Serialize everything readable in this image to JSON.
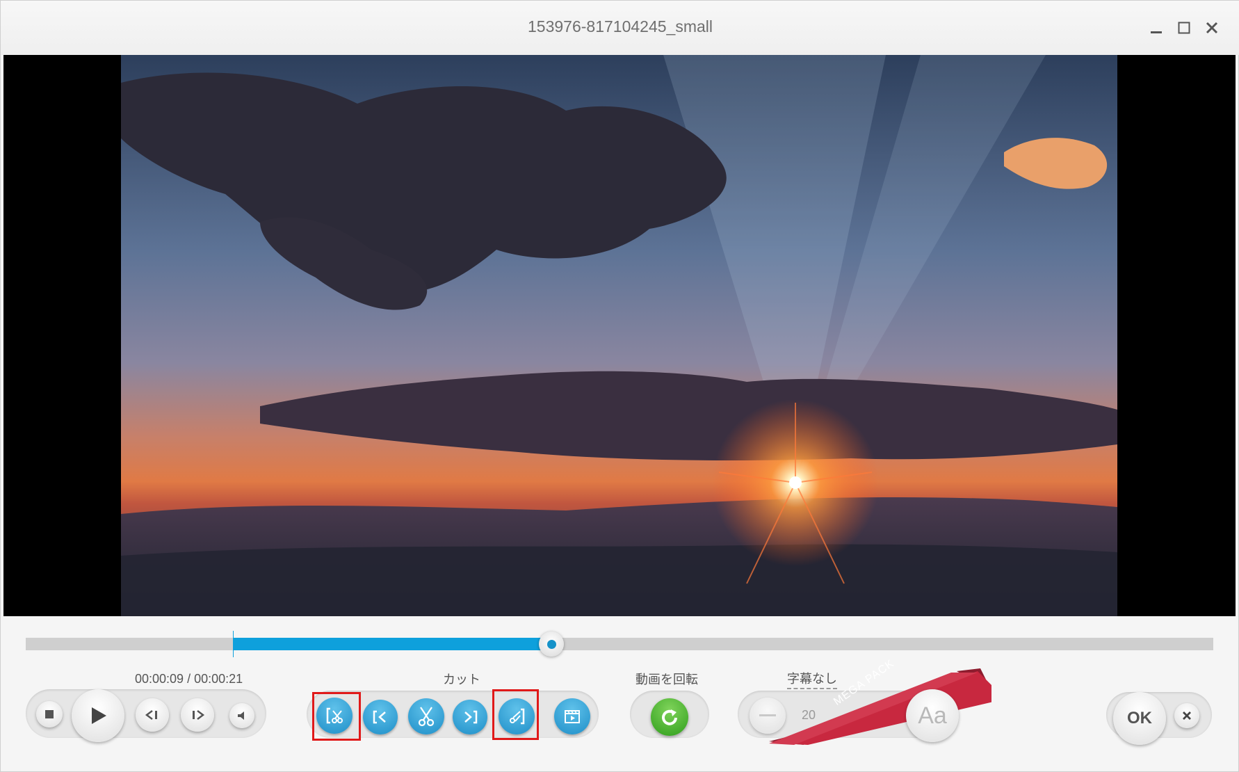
{
  "window": {
    "title": "153976-817104245_small"
  },
  "player": {
    "time_display": "00:00:09 / 00:00:21",
    "position_fraction": 0.4428,
    "selection_start_fraction": 0.1745,
    "selection_end_fraction": 0.4428
  },
  "cut": {
    "label": "カット"
  },
  "rotate": {
    "label": "動画を回転"
  },
  "subtitles": {
    "label": "字幕なし",
    "font_size_value": "20"
  },
  "promo": {
    "ribbon_text": "MEGA PACK"
  },
  "actions": {
    "ok_label": "OK"
  },
  "colors": {
    "accent": "#0ea0dc",
    "rotate_green": "#35a520",
    "promo_red": "#c8283f",
    "highlight_red": "#e01919"
  }
}
